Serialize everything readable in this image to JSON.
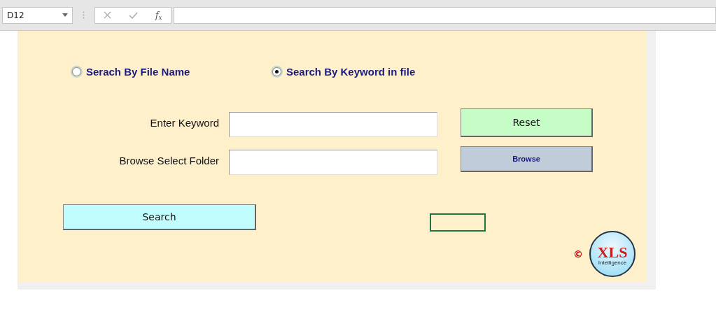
{
  "formula_bar": {
    "name_box": "D12",
    "function_button": "f$_{x}$"
  },
  "search_mode": [
    {
      "label": "Serach By File Name",
      "selected": false
    },
    {
      "label": "Search By Keyword in file",
      "selected": true
    }
  ],
  "fields": [
    {
      "label": "Enter Keyword"
    },
    {
      "label": "Browse Select Folder"
    }
  ],
  "buttons": [
    {
      "kind": "reset",
      "label": "Reset"
    },
    {
      "kind": "browse",
      "label": "Browse"
    },
    {
      "kind": "search",
      "label": "Search"
    }
  ],
  "footer": {
    "copyright": "©",
    "logo_mark": "XLS",
    "logo_caption": "Intelligence"
  }
}
